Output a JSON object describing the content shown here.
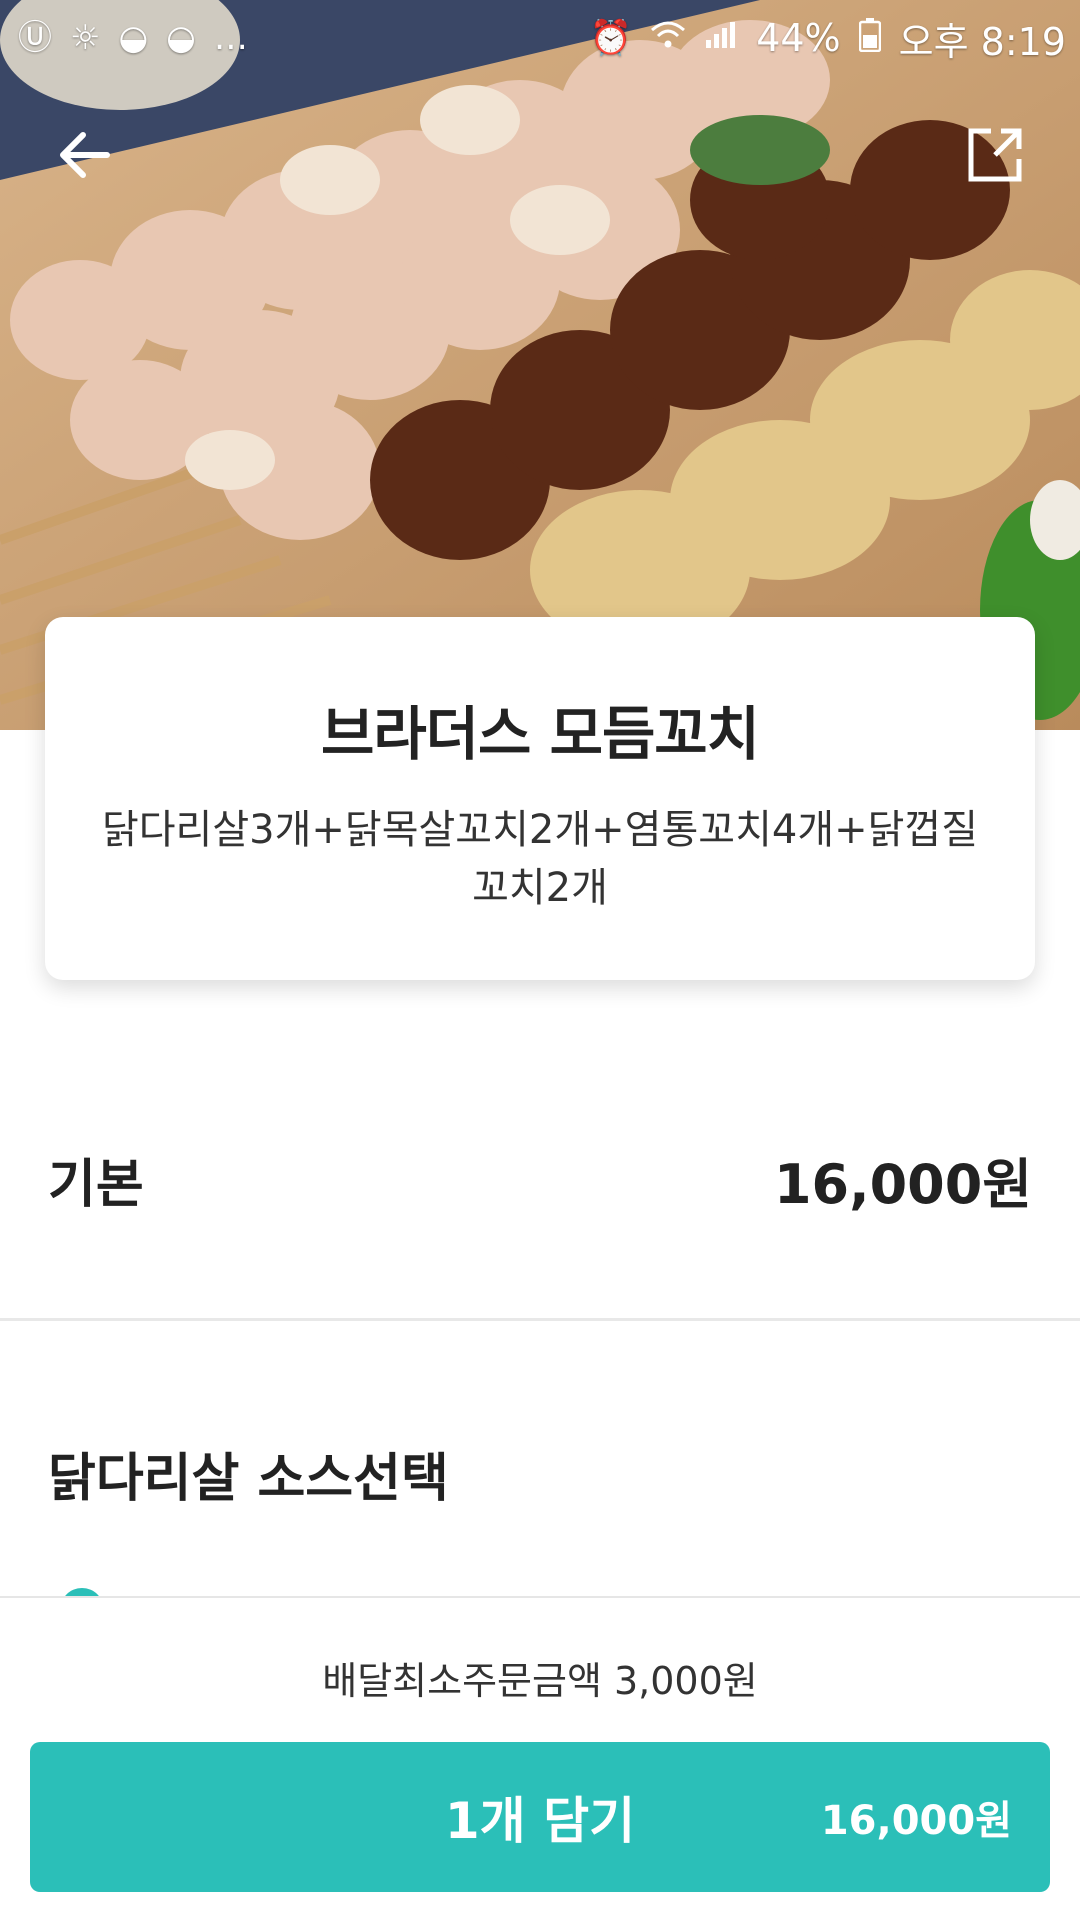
{
  "status_bar": {
    "left_icons": [
      "u-app-icon",
      "weather-icon",
      "food-bowl-icon",
      "food-bowl-icon",
      "more-notifications-icon"
    ],
    "battery": "44%",
    "time": "오후 8:19"
  },
  "nav": {
    "back_icon": "arrow-left-icon",
    "share_icon": "external-share-icon"
  },
  "menu": {
    "title": "브라더스 모듬꼬치",
    "description": "닭다리살3개+닭목살꼬치2개+염통꼬치4개+닭껍질꼬치2개"
  },
  "base": {
    "label": "기본",
    "price": "16,000원"
  },
  "option_group": {
    "title": "닭다리살 소스선택"
  },
  "footer": {
    "min_order": "배달최소주문금액 3,000원",
    "add_button_label": "1개 담기",
    "add_button_price": "16,000원"
  },
  "colors": {
    "accent": "#2bbfb8",
    "text": "#222222"
  }
}
